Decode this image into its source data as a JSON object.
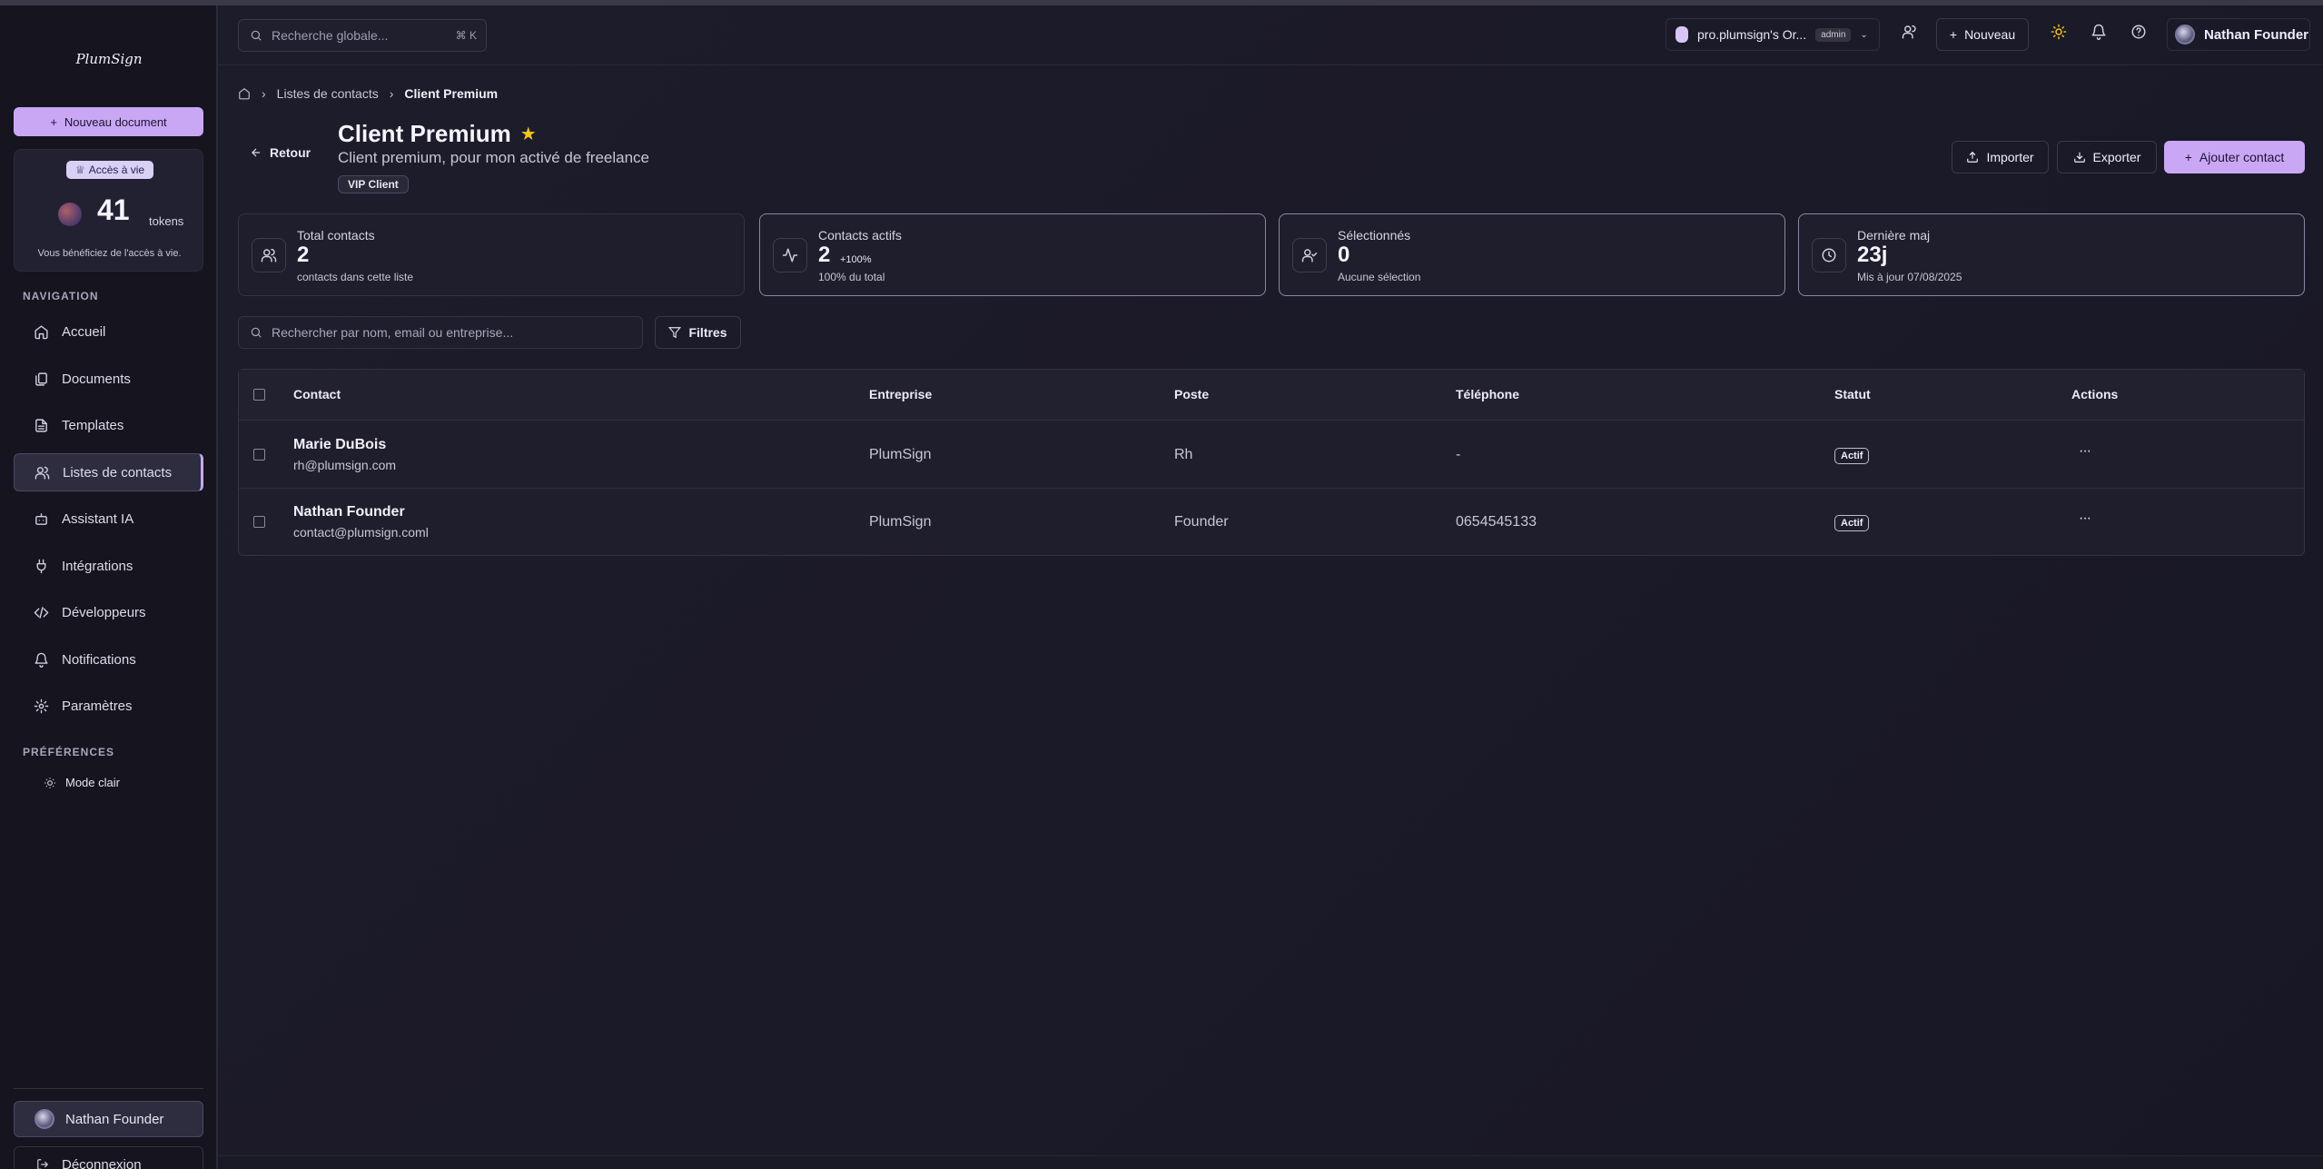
{
  "sidebar": {
    "logo": "PlumSign",
    "new_doc_label": "Nouveau document",
    "access_badge": "Accès à vie",
    "tokens_count": "41",
    "tokens_unit": "tokens",
    "tokens_note": "Vous bénéficiez de l'accès à vie.",
    "nav_title": "NAVIGATION",
    "items": [
      {
        "label": "Accueil",
        "icon": "home-icon"
      },
      {
        "label": "Documents",
        "icon": "documents-icon"
      },
      {
        "label": "Templates",
        "icon": "template-icon"
      },
      {
        "label": "Listes de contacts",
        "icon": "users-icon",
        "active": true
      },
      {
        "label": "Assistant IA",
        "icon": "bot-icon"
      },
      {
        "label": "Intégrations",
        "icon": "plug-icon"
      },
      {
        "label": "Développeurs",
        "icon": "code-icon"
      },
      {
        "label": "Notifications",
        "icon": "bell-icon"
      },
      {
        "label": "Paramètres",
        "icon": "settings-icon"
      }
    ],
    "pref_title": "PRÉFÉRENCES",
    "mode_label": "Mode clair",
    "user_name": "Nathan Founder",
    "logout_label": "Déconnexion"
  },
  "topbar": {
    "search_placeholder": "Recherche globale...",
    "search_kbd": "⌘ K",
    "org_name": "pro.plumsign's Or...",
    "org_role": "admin",
    "new_label": "Nouveau",
    "user_name": "Nathan Founder"
  },
  "breadcrumb": {
    "parent": "Listes de contacts",
    "current": "Client Premium"
  },
  "header": {
    "back_label": "Retour",
    "title": "Client Premium",
    "subtitle": "Client premium, pour mon activé de freelance",
    "tag": "VIP Client",
    "import_label": "Importer",
    "export_label": "Exporter",
    "add_label": "Ajouter contact"
  },
  "stats": [
    {
      "label": "Total contacts",
      "value": "2",
      "trend": "",
      "desc": "contacts dans cette liste",
      "icon": "users-icon"
    },
    {
      "label": "Contacts actifs",
      "value": "2",
      "trend": "+100%",
      "desc": "100% du total",
      "icon": "activity-icon"
    },
    {
      "label": "Sélectionnés",
      "value": "0",
      "trend": "",
      "desc": "Aucune sélection",
      "icon": "user-check-icon"
    },
    {
      "label": "Dernière maj",
      "value": "23j",
      "trend": "",
      "desc": "Mis à jour 07/08/2025",
      "icon": "clock-icon"
    }
  ],
  "filters": {
    "search_placeholder": "Rechercher par nom, email ou entreprise...",
    "filters_label": "Filtres"
  },
  "table": {
    "headers": [
      "Contact",
      "Entreprise",
      "Poste",
      "Téléphone",
      "Statut",
      "Actions"
    ],
    "rows": [
      {
        "name": "Marie DuBois",
        "email": "rh@plumsign.com",
        "company": "PlumSign",
        "position": "Rh",
        "phone": "-",
        "status": "Actif"
      },
      {
        "name": "Nathan Founder",
        "email": "contact@plumsign.coml",
        "company": "PlumSign",
        "position": "Founder",
        "phone": "0654545133",
        "status": "Actif"
      }
    ],
    "more_label": "···"
  },
  "colors": {
    "accent": "#c9a7f5",
    "background": "#1b1a28",
    "sidebar": "#15141f",
    "star": "#f5c518"
  }
}
